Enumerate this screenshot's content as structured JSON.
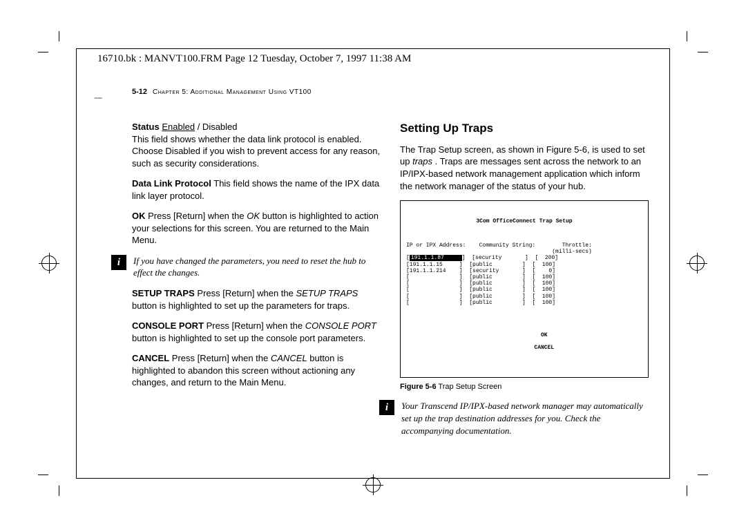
{
  "frame_header": "16710.bk : MANVT100.FRM  Page 12  Tuesday, October 7, 1997  11:38 AM",
  "running_head": {
    "page": "5-12",
    "chapter": "Chapter 5: Additional Management Using VT100"
  },
  "left_col": {
    "status_label": "Status",
    "status_enabled": "Enabled",
    "status_disabled": " / Disabled",
    "status_desc": "This field shows whether the data link protocol is enabled. Choose Disabled if you wish to prevent access for any reason, such as security considerations.",
    "dlp_label": "Data Link Protocol",
    "dlp_desc": " This field shows the name of the IPX data link layer protocol.",
    "ok_label": "OK",
    "ok_desc1": " Press [Return] when the ",
    "ok_ital": "OK",
    "ok_desc2": " button is highlighted to action your selections for this screen. You are returned to the Main Menu.",
    "note1": "If you have changed the parameters, you need to reset the hub to effect the changes.",
    "setup_label": "SETUP TRAPS",
    "setup_desc1": " Press [Return] when the ",
    "setup_ital": "SETUP TRAPS",
    "setup_desc2": " button is highlighted to set up the parameters for traps.",
    "console_label": "CONSOLE PORT",
    "console_desc1": " Press [Return] when the ",
    "console_ital": "CONSOLE PORT",
    "console_desc2": " button is highlighted to set up the console port parameters.",
    "cancel_label": "CANCEL",
    "cancel_desc1": " Press [Return] when the ",
    "cancel_ital": "CANCEL",
    "cancel_desc2": " button is highlighted to abandon this screen without actioning any changes, and return to the Main Menu."
  },
  "right_col": {
    "heading": "Setting Up Traps",
    "intro1": "The Trap Setup screen, as shown in Figure 5-6, is used to set up ",
    "intro_ital": "traps",
    "intro2": ". Traps are messages sent across the network to an IP/IPX-based network management application which inform the network manager of the status of your hub.",
    "fig_title": "3Com OfficeConnect Trap Setup",
    "fig_headers": {
      "ip": "IP or IPX Address:",
      "cs": "Community String:",
      "thr": "Throttle:",
      "thr_unit": "(milli-secs)"
    },
    "fig_rows": [
      {
        "ip": "191.1.1.87",
        "cs": "security",
        "thr": "200",
        "hl": true
      },
      {
        "ip": "191.1.1.15",
        "cs": "public",
        "thr": "100"
      },
      {
        "ip": "191.1.1.214",
        "cs": "security",
        "thr": "0"
      },
      {
        "ip": "",
        "cs": "public",
        "thr": "100"
      },
      {
        "ip": "",
        "cs": "public",
        "thr": "100"
      },
      {
        "ip": "",
        "cs": "public",
        "thr": "100"
      },
      {
        "ip": "",
        "cs": "public",
        "thr": "100"
      },
      {
        "ip": "",
        "cs": "public",
        "thr": "100"
      }
    ],
    "fig_ok": "OK",
    "fig_cancel": "CANCEL",
    "fig_caption_bold": "Figure 5-6",
    "fig_caption": "  Trap Setup Screen",
    "note2": "Your Transcend IP/IPX-based network manager may automatically set up the trap destination addresses for you. Check the accompanying documentation."
  }
}
